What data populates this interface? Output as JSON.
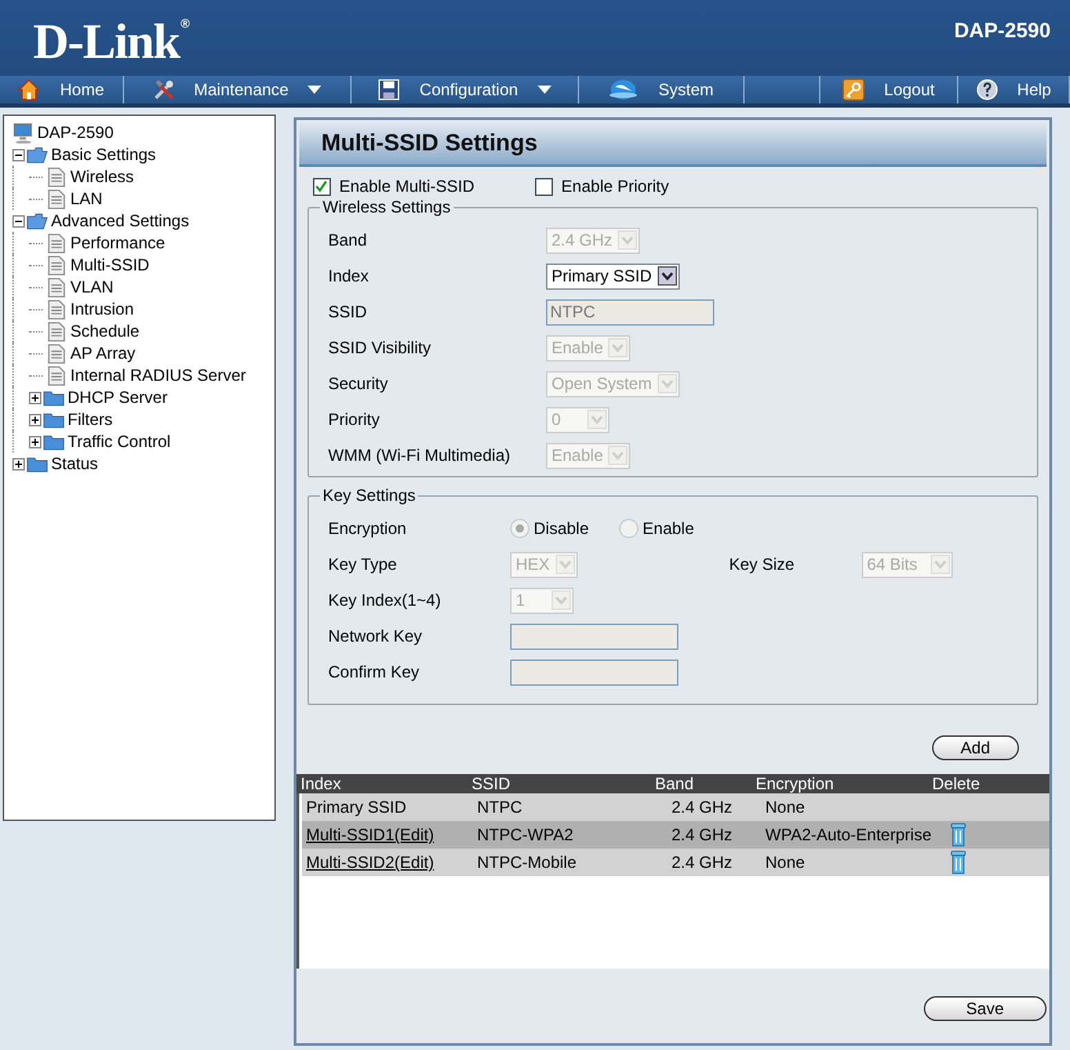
{
  "header": {
    "logo": "D-Link",
    "logo_mark": "®",
    "model": "DAP-2590"
  },
  "nav": [
    {
      "label": "Home",
      "dropdown": false
    },
    {
      "label": "Maintenance",
      "dropdown": true
    },
    {
      "label": "Configuration",
      "dropdown": true
    },
    {
      "label": "System",
      "dropdown": false
    },
    {
      "label": "Logout",
      "dropdown": false
    },
    {
      "label": "Help",
      "dropdown": false
    }
  ],
  "sidebar": {
    "items": [
      {
        "label": "DAP-2590",
        "kind": "root"
      },
      {
        "label": "Basic Settings",
        "kind": "folder",
        "expanded": true,
        "children": [
          {
            "label": "Wireless",
            "kind": "page"
          },
          {
            "label": "LAN",
            "kind": "page"
          }
        ]
      },
      {
        "label": "Advanced Settings",
        "kind": "folder",
        "expanded": true,
        "children": [
          {
            "label": "Performance",
            "kind": "page"
          },
          {
            "label": "Multi-SSID",
            "kind": "page"
          },
          {
            "label": "VLAN",
            "kind": "page"
          },
          {
            "label": "Intrusion",
            "kind": "page"
          },
          {
            "label": "Schedule",
            "kind": "page"
          },
          {
            "label": "AP Array",
            "kind": "page"
          },
          {
            "label": "Internal RADIUS Server",
            "kind": "page"
          },
          {
            "label": "DHCP Server",
            "kind": "folder",
            "expanded": false
          },
          {
            "label": "Filters",
            "kind": "folder",
            "expanded": false
          },
          {
            "label": "Traffic Control",
            "kind": "folder",
            "expanded": false
          }
        ]
      },
      {
        "label": "Status",
        "kind": "folder",
        "expanded": false
      }
    ]
  },
  "panel": {
    "title": "Multi-SSID Settings",
    "options": [
      {
        "label": "Enable Multi-SSID",
        "checked": true
      },
      {
        "label": "Enable Priority",
        "checked": false
      }
    ],
    "wireless_settings": {
      "title": "Wireless Settings",
      "fields": [
        {
          "label": "Band",
          "kind": "select",
          "value": "2.4 GHz",
          "disabled": true
        },
        {
          "label": "Index",
          "kind": "select",
          "value": "Primary SSID",
          "disabled": false
        },
        {
          "label": "SSID",
          "kind": "text",
          "value": "NTPC",
          "disabled": true
        },
        {
          "label": "SSID Visibility",
          "kind": "select",
          "value": "Enable",
          "disabled": true
        },
        {
          "label": "Security",
          "kind": "select",
          "value": "Open System",
          "disabled": true
        },
        {
          "label": "Priority",
          "kind": "select",
          "value": "0",
          "disabled": true
        },
        {
          "label": "WMM (Wi-Fi Multimedia)",
          "kind": "select",
          "value": "Enable",
          "disabled": true
        }
      ]
    },
    "key_settings": {
      "title": "Key Settings",
      "rows": [
        [
          {
            "label": "Encryption",
            "kind": "radio",
            "disabled": true,
            "options": [
              {
                "label": "Disable",
                "selected": true
              },
              {
                "label": "Enable",
                "selected": false
              }
            ]
          }
        ],
        [
          {
            "label": "Key Type",
            "kind": "select",
            "value": "HEX",
            "disabled": true
          },
          {
            "label": "Key Size",
            "kind": "select",
            "value": "64 Bits",
            "disabled": true
          }
        ],
        [
          {
            "label": "Key Index(1~4)",
            "kind": "select",
            "value": "1",
            "disabled": true
          }
        ],
        [
          {
            "label": "Network Key",
            "kind": "text",
            "disabled": true
          }
        ],
        [
          {
            "label": "Confirm Key",
            "kind": "text",
            "disabled": true
          }
        ]
      ]
    },
    "add_button": "Add",
    "table": {
      "columns": [
        "Index",
        "SSID",
        "Band",
        "Encryption",
        "Delete"
      ],
      "rows": [
        {
          "index": "Primary SSID",
          "link": false,
          "ssid": "NTPC",
          "band": "2.4 GHz",
          "encryption": "None",
          "deletable": false
        },
        {
          "index": "Multi-SSID1(Edit)",
          "link": true,
          "ssid": "NTPC-WPA2",
          "band": "2.4 GHz",
          "encryption": "WPA2-Auto-Enterprise",
          "deletable": true
        },
        {
          "index": "Multi-SSID2(Edit)",
          "link": true,
          "ssid": "NTPC-Mobile",
          "band": "2.4 GHz",
          "encryption": "None",
          "deletable": true
        }
      ]
    },
    "save_button": "Save"
  }
}
